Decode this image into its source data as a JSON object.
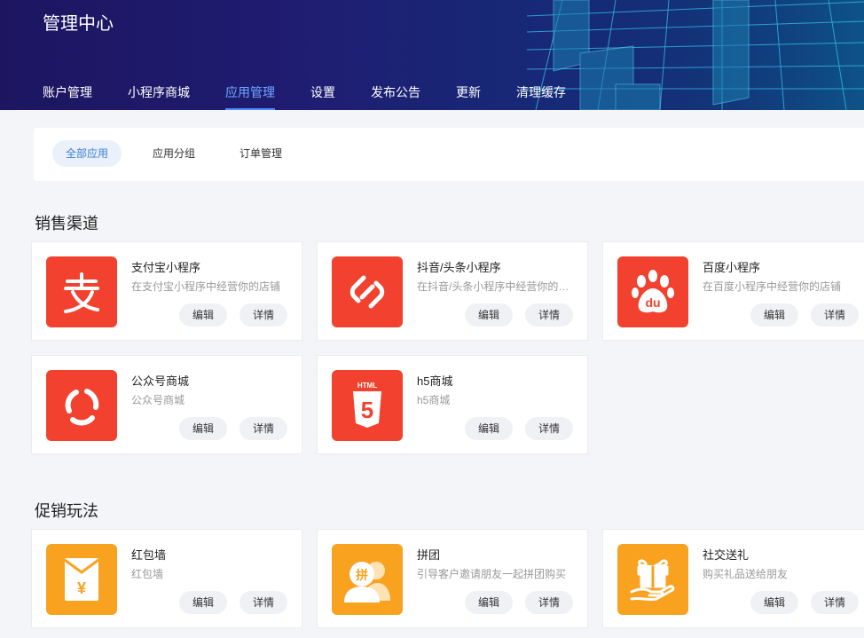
{
  "header": {
    "title": "管理中心",
    "nav": [
      {
        "label": "账户管理"
      },
      {
        "label": "小程序商城"
      },
      {
        "label": "应用管理",
        "active": true
      },
      {
        "label": "设置"
      },
      {
        "label": "发布公告"
      },
      {
        "label": "更新"
      },
      {
        "label": "清理缓存"
      }
    ]
  },
  "tabs": [
    {
      "label": "全部应用",
      "active": true
    },
    {
      "label": "应用分组"
    },
    {
      "label": "订单管理"
    }
  ],
  "sections": [
    {
      "title": "销售渠道",
      "cards": [
        {
          "name": "支付宝小程序",
          "desc": "在支付宝小程序中经营你的店铺",
          "icon": "alipay-icon",
          "color": "#f2412e",
          "edit": "编辑",
          "detail": "详情"
        },
        {
          "name": "抖音/头条小程序",
          "desc": "在抖音/头条小程序中经营你的店铺",
          "icon": "douyin-link-icon",
          "color": "#f2412e",
          "edit": "编辑",
          "detail": "详情"
        },
        {
          "name": "百度小程序",
          "desc": "在百度小程序中经营你的店铺",
          "icon": "baidu-paw-icon",
          "color": "#f2412e",
          "edit": "编辑",
          "detail": "详情"
        },
        {
          "name": "公众号商城",
          "desc": "公众号商城",
          "icon": "official-account-icon",
          "color": "#f2412e",
          "edit": "编辑",
          "detail": "详情"
        },
        {
          "name": "h5商城",
          "desc": "h5商城",
          "icon": "html5-icon",
          "color": "#f2412e",
          "edit": "编辑",
          "detail": "详情"
        }
      ]
    },
    {
      "title": "促销玩法",
      "cards": [
        {
          "name": "红包墙",
          "desc": "红包墙",
          "icon": "red-envelope-icon",
          "color": "#f9a21f",
          "edit": "编辑",
          "detail": "详情"
        },
        {
          "name": "拼团",
          "desc": "引导客户邀请朋友一起拼团购买",
          "icon": "group-buy-icon",
          "color": "#f9a21f",
          "edit": "编辑",
          "detail": "详情"
        },
        {
          "name": "社交送礼",
          "desc": "购买礼品送给朋友",
          "icon": "gift-icon",
          "color": "#f9a21f",
          "edit": "编辑",
          "detail": "详情"
        }
      ]
    }
  ],
  "icon_labels": {
    "html5_text": "HTML",
    "html5_num": "5",
    "baidu_text": "du",
    "group_text": "拼",
    "yuan": "¥"
  },
  "colors": {
    "accent_blue": "#4a8cff",
    "icon_red": "#f2412e",
    "icon_orange": "#f9a21f"
  }
}
